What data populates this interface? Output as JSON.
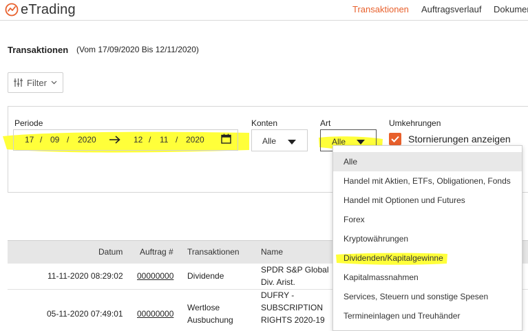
{
  "header": {
    "logo_text": "eTrading",
    "nav": [
      "Transaktionen",
      "Auftragsverlauf",
      "Dokumen"
    ],
    "active_color": "#e8602c"
  },
  "page": {
    "title": "Transaktionen",
    "range": "(Vom 17/09/2020 Bis 12/11/2020)"
  },
  "filter_button": {
    "label": "Filter"
  },
  "filters": {
    "periode_label": "Periode",
    "from": {
      "day": "17",
      "month": "09",
      "year": "2020"
    },
    "to": {
      "day": "12",
      "month": "11",
      "year": "2020"
    },
    "separator": "/",
    "konten_label": "Konten",
    "konten_value": "Alle",
    "art_label": "Art",
    "art_value": "Alle",
    "umkehrungen_label": "Umkehrungen",
    "stornierungen_label": "Stornierungen anzeigen",
    "stornierungen_checked": true
  },
  "table": {
    "headers": [
      "Datum",
      "Auftrag #",
      "Transaktionen",
      "Name"
    ],
    "rows": [
      {
        "datum": "11-11-2020 08:29:02",
        "auftrag": "00000000",
        "transaktion": [
          "Dividende"
        ],
        "name": [
          "SPDR S&P Global",
          "Div. Arist."
        ]
      },
      {
        "datum": "05-11-2020 07:49:01",
        "auftrag": "00000000",
        "transaktion": [
          "Wertlose",
          "Ausbuchung"
        ],
        "name": [
          "DUFRY -",
          "SUBSCRIPTION",
          "RIGHTS 2020-19"
        ]
      }
    ]
  },
  "art_dropdown": {
    "options": [
      "Alle",
      "Handel mit Aktien, ETFs, Obligationen, Fonds",
      "Handel mit Optionen und Futures",
      "Forex",
      "Kryptowährungen",
      "Dividenden/Kapitalgewinne",
      "Kapitalmassnahmen",
      "Services, Steuern und sonstige Spesen",
      "Termineinlagen und Treuhänder"
    ],
    "selected_index": 0,
    "highlighted_index": 5
  },
  "highlight_color": "#ffff3a"
}
